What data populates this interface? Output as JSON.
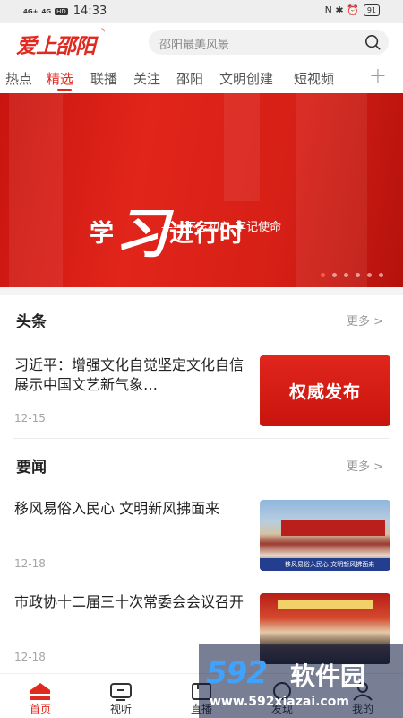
{
  "status_bar": {
    "signal1": "4G+",
    "signal2": "4G",
    "hd": "HD",
    "time": "14:33",
    "right_icons": "N ✱ ⏰",
    "battery": "91"
  },
  "header": {
    "logo": "爱上邵阳",
    "search_placeholder": "邵阳最美风景"
  },
  "tabs": [
    "热点",
    "精选",
    "联播",
    "关注",
    "邵阳",
    "文明创建",
    "短视频"
  ],
  "active_tab_index": 1,
  "banner": {
    "title_left": "学",
    "title_script": "习",
    "title_right": "进行时",
    "subtitle": "——不忘初心 牢记使命",
    "slide_count": 6,
    "active_slide": 0
  },
  "headlines": {
    "title": "头条",
    "more": "更多 >",
    "items": [
      {
        "title": "习近平：增强文化自觉坚定文化自信 展示中国文艺新气象…",
        "date": "12-15",
        "thumb_text": "权威发布"
      }
    ]
  },
  "news": {
    "title": "要闻",
    "more": "更多 >",
    "items": [
      {
        "title": "移风易俗入民心 文明新风拂面来",
        "date": "12-18",
        "thumb_caption": "移风易俗入民心 文明新风拂面来"
      },
      {
        "title": "市政协十二届三十次常委会会议召开",
        "date": "12-18"
      }
    ]
  },
  "bottom_nav": [
    {
      "label": "首页",
      "icon": "home-icon"
    },
    {
      "label": "视听",
      "icon": "tv-icon"
    },
    {
      "label": "直播",
      "icon": "live-icon"
    },
    {
      "label": "发现",
      "icon": "discover-icon"
    },
    {
      "label": "我的",
      "icon": "user-icon"
    }
  ],
  "watermark": {
    "brand": "592",
    "name": "软件园",
    "url": "www.592xiazai.com"
  },
  "colors": {
    "accent": "#e02a20",
    "banner": "#d61f16",
    "watermark_blue": "#3ea2ff"
  }
}
